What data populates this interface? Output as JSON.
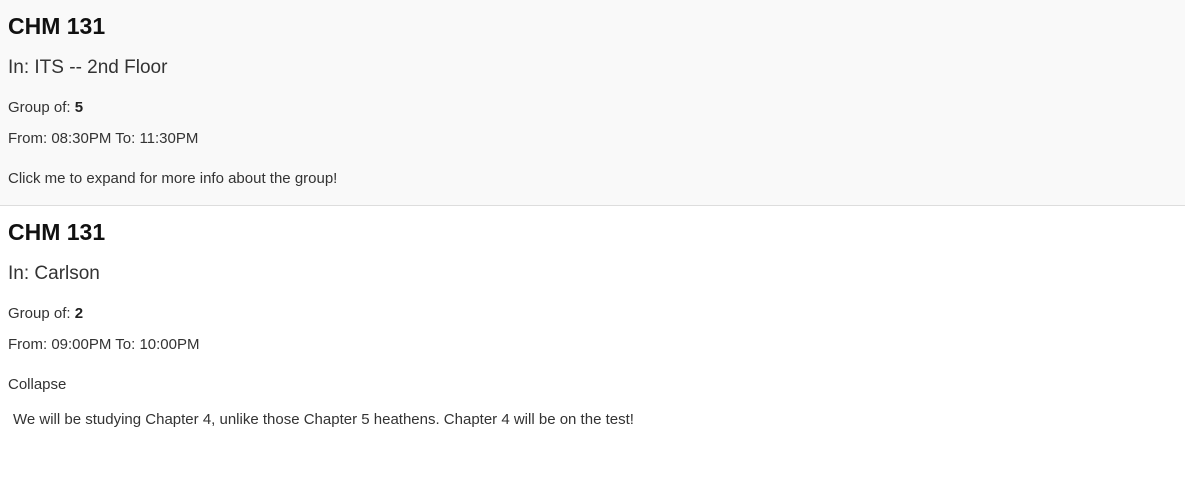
{
  "groups": [
    {
      "course": "CHM 131",
      "location": "In: ITS -- 2nd Floor",
      "size_label": "Group of: ",
      "size": "5",
      "time": "From: 08:30PM To: 11:30PM",
      "toggle_label": "Click me to expand for more info about the group!"
    },
    {
      "course": "CHM 131",
      "location": "In: Carlson",
      "size_label": "Group of: ",
      "size": "2",
      "time": "From: 09:00PM To: 10:00PM",
      "toggle_label": "Collapse",
      "description": "We will be studying Chapter 4, unlike those Chapter 5 heathens. Chapter 4 will be on the test!"
    }
  ]
}
